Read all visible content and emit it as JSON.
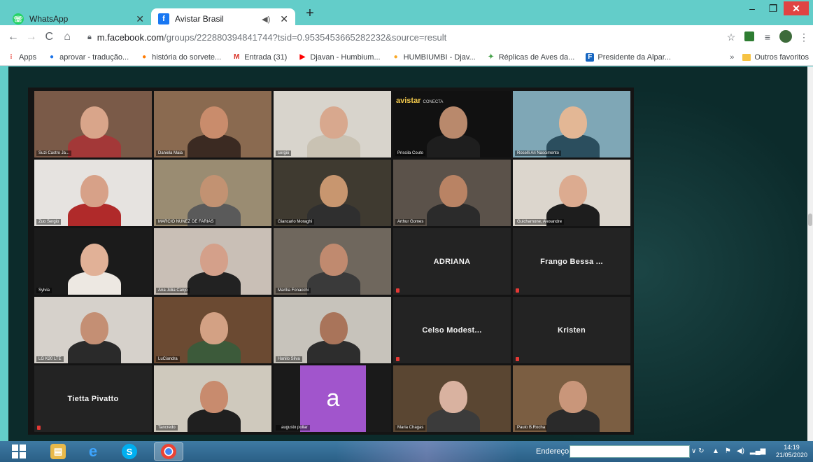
{
  "browser": {
    "tabs": [
      {
        "title": "WhatsApp",
        "active": false,
        "icon": "whatsapp-icon"
      },
      {
        "title": "Avistar Brasil",
        "active": true,
        "icon": "facebook-icon"
      }
    ],
    "url_host": "m.facebook.com",
    "url_path": "/groups/222880394841744?tsid=0.9535453665282232&source=result"
  },
  "bookmarks": {
    "items": [
      {
        "label": "Apps",
        "icon": "apps-grid-icon",
        "color": "#e8453c"
      },
      {
        "label": "aprovar - tradução...",
        "icon": "location-pin-icon",
        "color": "#1a73e8"
      },
      {
        "label": "história do sorvete...",
        "icon": "circle-icon",
        "color": "#ff7a00"
      },
      {
        "label": "Entrada (31)",
        "icon": "gmail-icon",
        "color": "#d93025"
      },
      {
        "label": "Djavan - Humbium...",
        "icon": "youtube-icon",
        "color": "#ff0000"
      },
      {
        "label": "HUMBIUMBI - Djav...",
        "icon": "shield-icon",
        "color": "#f9a825"
      },
      {
        "label": "Réplicas de Aves da...",
        "icon": "bird-icon",
        "color": "#43a047"
      },
      {
        "label": "Presidente da Alpar...",
        "icon": "f-logo-icon",
        "color": "#1565c0"
      }
    ],
    "overflow": "»",
    "other_folder": "Outros favoritos"
  },
  "meeting": {
    "tiles": [
      {
        "name": "Suzi Castro Ja...",
        "kind": "video",
        "bg": "#7a5a48",
        "skin": "#d9a58a",
        "shirt": "#a33838"
      },
      {
        "name": "Daniela Maia",
        "kind": "video",
        "bg": "#8a6a50",
        "skin": "#c98c6c",
        "shirt": "#3b2a22"
      },
      {
        "name": "sergio",
        "kind": "video",
        "bg": "#d8d4cc",
        "skin": "#d8a88e",
        "shirt": "#c9c2b3"
      },
      {
        "name": "Priscila Couto",
        "kind": "logo",
        "bg": "#111111",
        "skin": "#b9896c",
        "shirt": "#1e1e1e"
      },
      {
        "name": "Roselli Ari Nascimento",
        "kind": "video",
        "bg": "#7fa7b6",
        "skin": "#e3b795",
        "shirt": "#2b4e5e"
      },
      {
        "name": "Zuo Sergio",
        "kind": "video",
        "bg": "#e6e3e0",
        "skin": "#d7a188",
        "shirt": "#b02a2a"
      },
      {
        "name": "MARCIO NUNEZ DE FARIAS",
        "kind": "video",
        "bg": "#9a8c72",
        "skin": "#c29272",
        "shirt": "#5a5a5a"
      },
      {
        "name": "Giancarlo Moraghi",
        "kind": "video",
        "bg": "#3f3a30",
        "skin": "#c8966f",
        "shirt": "#2f2f2f"
      },
      {
        "name": "Arthur Gomes",
        "kind": "video",
        "bg": "#5b524a",
        "skin": "#b98364",
        "shirt": "#2b2b2b"
      },
      {
        "name": "Guichamone, Alexandre",
        "kind": "video",
        "bg": "#dcd6cd",
        "skin": "#dcab90",
        "shirt": "#1d1d1d"
      },
      {
        "name": "Sylvia",
        "kind": "video",
        "bg": "#1b1b1b",
        "skin": "#e1b197",
        "shirt": "#ede8e2"
      },
      {
        "name": "Ana Júlia Canjo",
        "kind": "video",
        "bg": "#c9bfb6",
        "skin": "#d4a08a",
        "shirt": "#222222"
      },
      {
        "name": "Marília Fonacchi",
        "kind": "video",
        "bg": "#6f675d",
        "skin": "#c08a6f",
        "shirt": "#3a3a3a"
      },
      {
        "name": "ADRIANA",
        "kind": "name"
      },
      {
        "name": "Frango Bessa ...",
        "kind": "name"
      },
      {
        "name": "LG K20 LTE",
        "kind": "video",
        "bg": "#d6d1cb",
        "skin": "#c48f74",
        "shirt": "#2a2a2a"
      },
      {
        "name": "LuCiandra",
        "kind": "video",
        "bg": "#6b4a32",
        "skin": "#d3a184",
        "shirt": "#3c5a3a"
      },
      {
        "name": "Hanilo Silva",
        "kind": "video",
        "bg": "#c7c3bb",
        "skin": "#a9745a",
        "shirt": "#2d2d2d"
      },
      {
        "name": "Celso Modest...",
        "kind": "name"
      },
      {
        "name": "Kristen",
        "kind": "name"
      },
      {
        "name": "Tietta Pivatto",
        "kind": "name"
      },
      {
        "name": "Tancredo",
        "kind": "video",
        "bg": "#cfc9bd",
        "skin": "#c88b6e",
        "shirt": "#1f1f1f"
      },
      {
        "name": "augusto pollar",
        "kind": "avatar",
        "letter": "a"
      },
      {
        "name": "Maria Chagas",
        "kind": "video",
        "bg": "#5a4632",
        "skin": "#d9b2a0",
        "shirt": "#3b3b3b"
      },
      {
        "name": "Paulo B.Rocha",
        "kind": "video",
        "bg": "#7b5e42",
        "skin": "#c9967a",
        "shirt": "#2a2a2a"
      }
    ],
    "logo_text": "avistar",
    "logo_sub": "CONECTA"
  },
  "taskbar": {
    "address_label": "Endereço",
    "time": "14:19",
    "date": "21/05/2020"
  }
}
